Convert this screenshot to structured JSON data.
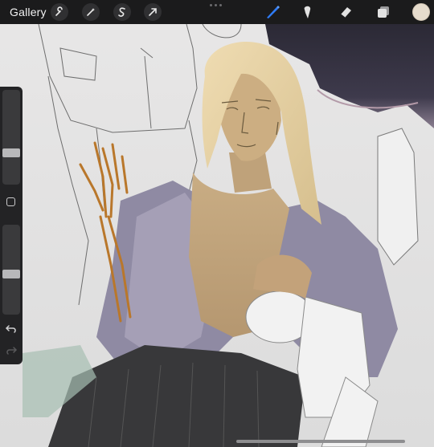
{
  "topbar": {
    "gallery_label": "Gallery",
    "left_tools": [
      "wrench-icon",
      "magic-wand-icon",
      "selection-icon",
      "transform-arrow-icon"
    ],
    "right_tools": [
      "brush-icon",
      "smudge-icon",
      "eraser-icon",
      "layers-icon"
    ],
    "active_tool": "brush-icon",
    "accent_color": "#2f7cf6",
    "current_color": "#e6dccd"
  },
  "sidebar": {
    "brush_size_level": 0.68,
    "opacity_level": 0.45,
    "buttons": [
      "modify-button",
      "undo-button",
      "redo-button"
    ]
  }
}
